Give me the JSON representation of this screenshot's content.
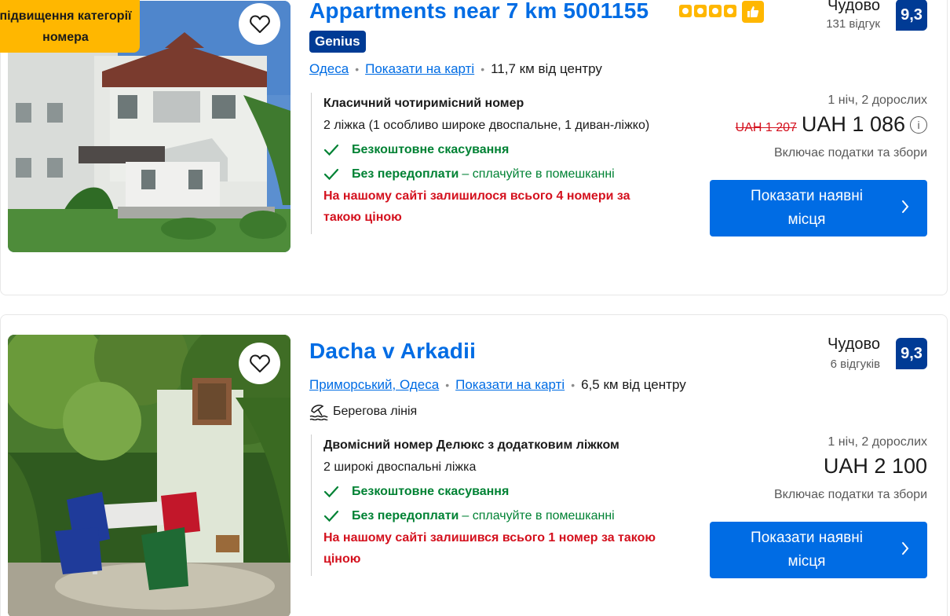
{
  "listings": [
    {
      "promo_badge": "Безкоштовне підвищення категорії номера",
      "title": "Appartments near 7 km 5001155",
      "genius_label": "Genius",
      "location": "Одеса",
      "map_link": "Показати на карті",
      "distance": "11,7 км від центру",
      "rating_word": "Чудово",
      "review_count": "131 відгук",
      "score": "9,3",
      "room_name": "Класичний чотиримісний номер",
      "beds": "2 ліжка (1 особливо широке двоспальне, 1 диван-ліжко)",
      "free_cancel": "Безкоштовне скасування",
      "no_prepay": "Без передоплати",
      "no_prepay_note": "– сплачуйте в помешканні",
      "scarcity": "На нашому сайті залишилося всього 4 номери за такою ціною",
      "nights_guests": "1 ніч, 2 дорослих",
      "old_price": "UAH 1 207",
      "price": "UAH 1 086",
      "taxes_note": "Включає податки та збори",
      "cta_label": "Показати наявні місця"
    },
    {
      "title": "Dacha v Arkadii",
      "location": "Приморський, Одеса",
      "map_link": "Показати на карті",
      "distance": "6,5 км від центру",
      "beach_label": "Берегова лінія",
      "rating_word": "Чудово",
      "review_count": "6 відгуків",
      "score": "9,3",
      "room_name": "Двомісний номер Делюкс з додатковим ліжком",
      "beds": "2 широкі двоспальні ліжка",
      "free_cancel": "Безкоштовне скасування",
      "no_prepay": "Без передоплати",
      "no_prepay_note": "– сплачуйте в помешканні",
      "scarcity": "На нашому сайті залишився всього 1 номер за такою ціною",
      "nights_guests": "1 ніч, 2 дорослих",
      "price": "UAH 2 100",
      "taxes_note": "Включає податки та збори",
      "cta_label": "Показати наявні місця"
    }
  ],
  "colors": {
    "link_blue": "#006ce4",
    "score_navy": "#003b95",
    "promo_yellow": "#ffb700",
    "success_green": "#008234",
    "urgent_red": "#d4111e"
  },
  "icons": [
    "heart-icon",
    "star-icon",
    "thumbs-up-icon",
    "checkmark-icon",
    "beach-icon",
    "chevron-right-icon",
    "info-icon"
  ]
}
